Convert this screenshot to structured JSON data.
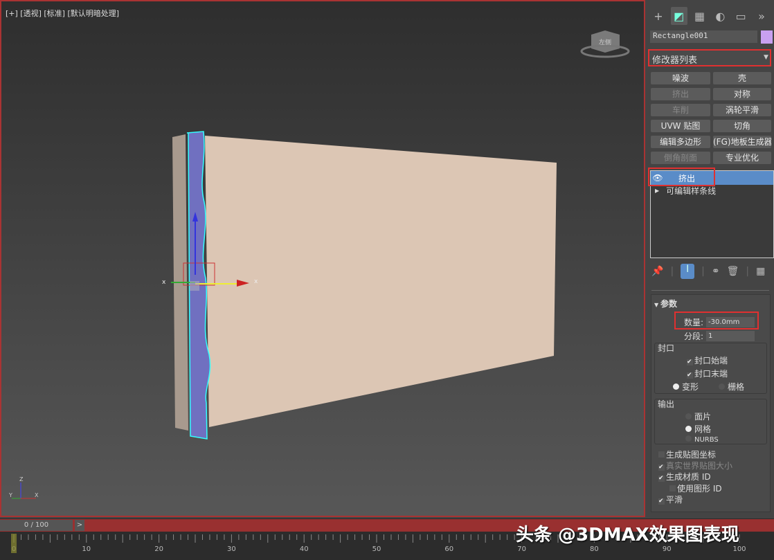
{
  "viewport": {
    "label": "[+] [透视] [标准] [默认明暗处理]",
    "viewcube": "左侧",
    "axis_labels": {
      "x": "X",
      "y": "Y",
      "z": "Z"
    }
  },
  "panel": {
    "tabs": [
      {
        "icon": "plus-icon"
      },
      {
        "icon": "modify-icon",
        "active": true
      },
      {
        "icon": "hierarchy-icon"
      },
      {
        "icon": "motion-icon"
      },
      {
        "icon": "display-icon"
      },
      {
        "icon": "more-icon"
      }
    ],
    "object_name": "Rectangle001",
    "object_color": "#c9a0f0",
    "modifier_list": "修改器列表",
    "buttons": [
      {
        "label": "噪波"
      },
      {
        "label": "壳"
      },
      {
        "label": "挤出",
        "disabled": true
      },
      {
        "label": "对称"
      },
      {
        "label": "车削",
        "disabled": true
      },
      {
        "label": "涡轮平滑"
      },
      {
        "label": "UVW 贴图"
      },
      {
        "label": "切角"
      },
      {
        "label": "编辑多边形"
      },
      {
        "label": "(FG)地板生成器"
      },
      {
        "label": "倒角剖面",
        "disabled": true
      },
      {
        "label": "专业优化"
      }
    ],
    "stack": [
      "挤出",
      "可编辑样条线"
    ],
    "params": {
      "title": "参数",
      "amount_label": "数量:",
      "amount": "-30.0mm",
      "segments_label": "分段:",
      "segments": "1",
      "capping": {
        "title": "封口",
        "start": "封口始端",
        "end": "封口末端",
        "morph": "变形",
        "grid": "栅格"
      },
      "output": {
        "title": "输出",
        "patch": "面片",
        "mesh": "网格",
        "nurbs": "NURBS"
      },
      "gen_mapping": "生成贴图坐标",
      "real_world": "真实世界贴图大小",
      "gen_matid": "生成材质 ID",
      "use_shape_id": "使用图形 ID",
      "smooth": "平滑"
    }
  },
  "timeline": {
    "slider": "0 / 100",
    "ticks": [
      "0",
      "10",
      "20",
      "30",
      "40",
      "50",
      "60",
      "70",
      "80",
      "90",
      "100"
    ],
    "current_frame": 0,
    "max_frame": 100
  },
  "watermark": "头条 @3DMAX效果图表现",
  "colors": {
    "accent": "#5a8cc8",
    "highlight": "#e03030",
    "object": "#dcc6b4",
    "selected": "#7070c0"
  }
}
